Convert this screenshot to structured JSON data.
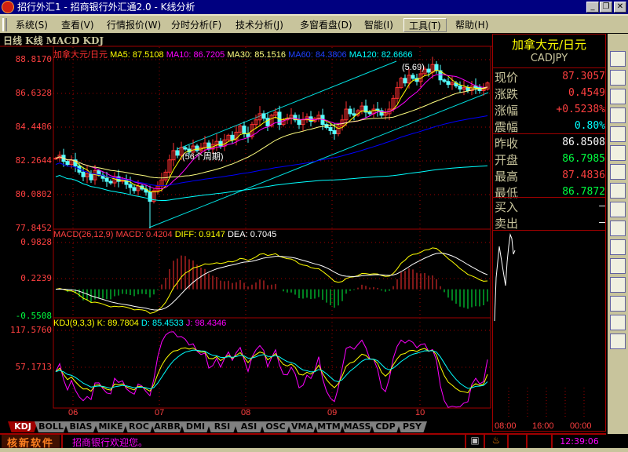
{
  "window": {
    "title": "招行外汇1 - 招商银行外汇通2.0 - K线分析",
    "minimize": "_",
    "restore": "❐",
    "close": "✕"
  },
  "menu": [
    {
      "label": "系统(S)"
    },
    {
      "label": "查看(V)"
    },
    {
      "label": "行情报价(W)"
    },
    {
      "label": "分时分析(F)"
    },
    {
      "label": "技术分析(J)"
    },
    {
      "label": "多窗看盘(D)"
    },
    {
      "label": "智能(I)"
    },
    {
      "label": "工具(T)"
    },
    {
      "label": "帮助(H)"
    }
  ],
  "header": "日线 K线 MACD KDJ",
  "price_panel": {
    "name": "加拿大元/日元",
    "ma": [
      {
        "label": "MA5: 87.5108",
        "color": "#ffff00"
      },
      {
        "label": "MA10: 86.7205",
        "color": "#ff00ff"
      },
      {
        "label": "MA30: 85.1516",
        "color": "#ffff80"
      },
      {
        "label": "MA60: 84.3806",
        "color": "#0000ff"
      },
      {
        "label": "MA120: 82.6666",
        "color": "#00ffff"
      }
    ],
    "axis": [
      "88.8170",
      "86.6328",
      "84.4486",
      "82.2644",
      "80.0802",
      "77.8452"
    ],
    "annot1": "(56个周期)",
    "annot2": "(5.69)"
  },
  "macd_panel": {
    "title": "MACD(26,12,9)",
    "macd": "MACD: 0.4204",
    "diff": "DIFF: 0.9147",
    "dea": "DEA: 0.7045",
    "axis": [
      "0.9828",
      "0.2239",
      "-0.5508"
    ]
  },
  "kdj_panel": {
    "title": "KDJ(9,3,3)",
    "k": "K: 89.7804",
    "d": "D: 85.4533",
    "j": "J: 98.4346",
    "axis": [
      "117.5760",
      "57.1713"
    ]
  },
  "months": [
    "06",
    "07",
    "08",
    "09",
    "10"
  ],
  "chart_data": {
    "type": "candlestick",
    "ylim": [
      77.8452,
      88.817
    ],
    "closes": [
      82.4,
      82.6,
      82.2,
      82.0,
      82.3,
      81.9,
      81.5,
      81.2,
      81.4,
      81.0,
      81.6,
      81.3,
      81.1,
      80.9,
      80.8,
      81.2,
      80.9,
      81.0,
      80.7,
      80.5,
      80.3,
      80.6,
      80.4,
      80.2,
      79.6,
      80.3,
      80.6,
      81.0,
      81.5,
      82.3,
      82.9,
      82.6,
      83.1,
      83.0,
      82.8,
      83.2,
      82.9,
      83.1,
      83.4,
      83.0,
      83.3,
      83.5,
      83.2,
      83.6,
      83.9,
      83.6,
      84.1,
      84.5,
      84.0,
      83.8,
      84.6,
      84.9,
      85.3,
      85.0,
      84.5,
      85.2,
      85.4,
      84.6,
      84.9,
      85.0,
      85.2,
      84.9,
      84.6,
      84.9,
      85.1,
      84.8,
      85.0,
      85.2,
      84.6,
      84.4,
      84.2,
      84.0,
      84.5,
      84.9,
      85.6,
      85.3,
      85.2,
      85.5,
      85.8,
      85.4,
      85.3,
      85.6,
      85.5,
      85.2,
      85.3,
      85.6,
      86.3,
      87.0,
      87.6,
      87.3,
      87.8,
      87.6,
      87.4,
      87.9,
      88.2,
      88.0,
      88.5,
      88.1,
      87.5,
      87.4,
      87.2,
      87.3,
      87.1,
      86.9,
      87.0,
      86.8,
      87.1,
      87.0,
      86.8,
      86.9,
      87.3
    ]
  },
  "quote": {
    "name": "加拿大元/日元",
    "code": "CADJPY",
    "rows": [
      {
        "k": "现价",
        "v": "87.3057",
        "c": "#ff4040"
      },
      {
        "k": "涨跌",
        "v": "0.4549",
        "c": "#ff4040"
      },
      {
        "k": "涨幅",
        "v": "+0.5238%",
        "c": "#ff4040"
      },
      {
        "k": "震幅",
        "v": "0.80%",
        "c": "#00ffff"
      },
      {
        "k": "昨收",
        "v": "86.8508",
        "c": "#ffffff"
      },
      {
        "k": "开盘",
        "v": "86.7985",
        "c": "#00ff40"
      },
      {
        "k": "最高",
        "v": "87.4836",
        "c": "#ff4040"
      },
      {
        "k": "最低",
        "v": "86.7872",
        "c": "#00ff40"
      },
      {
        "k": "买入",
        "v": "—",
        "c": "#ffffff"
      },
      {
        "k": "卖出",
        "v": "—",
        "c": "#ffffff"
      }
    ],
    "times": [
      "08:00",
      "16:00",
      "00:00"
    ]
  },
  "tabs": [
    "KDJ",
    "BOLL",
    "BIAS",
    "MIKE",
    "ROC",
    "ARBR",
    "DMI",
    "RSI",
    "ASI",
    "OSC",
    "VMA",
    "MTM",
    "MASS",
    "CDP",
    "PSY"
  ],
  "status": {
    "brand": "核新软件",
    "message": "招商银行欢迎您。",
    "clock": "12:39:06"
  }
}
